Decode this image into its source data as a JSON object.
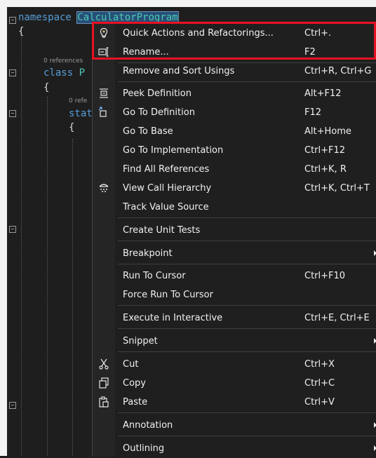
{
  "editor": {
    "line1_keyword": "namespace",
    "line1_name": "CalculatorProgram",
    "brace_open": "{",
    "codelens_references": "0 references",
    "codelens_references_short": "0 refe",
    "line_class_keyword": "class",
    "line_class_name_partial": "P",
    "line_static_partial": "stat"
  },
  "menu": {
    "items": [
      {
        "label": "Quick Actions and Refactorings...",
        "shortcut": "Ctrl+.",
        "icon": "lightbulb-icon"
      },
      {
        "label": "Rename...",
        "shortcut": "F2",
        "icon": "rename-icon"
      },
      {
        "label": "Remove and Sort Usings",
        "shortcut": "Ctrl+R, Ctrl+G",
        "icon": ""
      },
      {
        "label": "Peek Definition",
        "shortcut": "Alt+F12",
        "icon": "peek-definition-icon"
      },
      {
        "label": "Go To Definition",
        "shortcut": "F12",
        "icon": "go-to-definition-icon"
      },
      {
        "label": "Go To Base",
        "shortcut": "Alt+Home",
        "icon": ""
      },
      {
        "label": "Go To Implementation",
        "shortcut": "Ctrl+F12",
        "icon": ""
      },
      {
        "label": "Find All References",
        "shortcut": "Ctrl+K, R",
        "icon": ""
      },
      {
        "label": "View Call Hierarchy",
        "shortcut": "Ctrl+K, Ctrl+T",
        "icon": "call-hierarchy-icon"
      },
      {
        "label": "Track Value Source",
        "shortcut": "",
        "icon": ""
      },
      {
        "label": "Create Unit Tests",
        "shortcut": "",
        "icon": ""
      },
      {
        "label": "Breakpoint",
        "shortcut": "",
        "icon": "",
        "submenu": true
      },
      {
        "label": "Run To Cursor",
        "shortcut": "Ctrl+F10",
        "icon": ""
      },
      {
        "label": "Force Run To Cursor",
        "shortcut": "",
        "icon": ""
      },
      {
        "label": "Execute in Interactive",
        "shortcut": "Ctrl+E, Ctrl+E",
        "icon": ""
      },
      {
        "label": "Snippet",
        "shortcut": "",
        "icon": "",
        "submenu": true
      },
      {
        "label": "Cut",
        "shortcut": "Ctrl+X",
        "icon": "scissors-icon"
      },
      {
        "label": "Copy",
        "shortcut": "Ctrl+C",
        "icon": "copy-icon"
      },
      {
        "label": "Paste",
        "shortcut": "Ctrl+V",
        "icon": "paste-icon"
      },
      {
        "label": "Annotation",
        "shortcut": "",
        "icon": "",
        "submenu": true
      },
      {
        "label": "Outlining",
        "shortcut": "",
        "icon": "",
        "submenu": true
      }
    ]
  },
  "colors": {
    "keyword": "#569cd6",
    "type": "#4ec9b0",
    "highlight_border": "#e81123",
    "menu_background": "#1f1f1f"
  }
}
